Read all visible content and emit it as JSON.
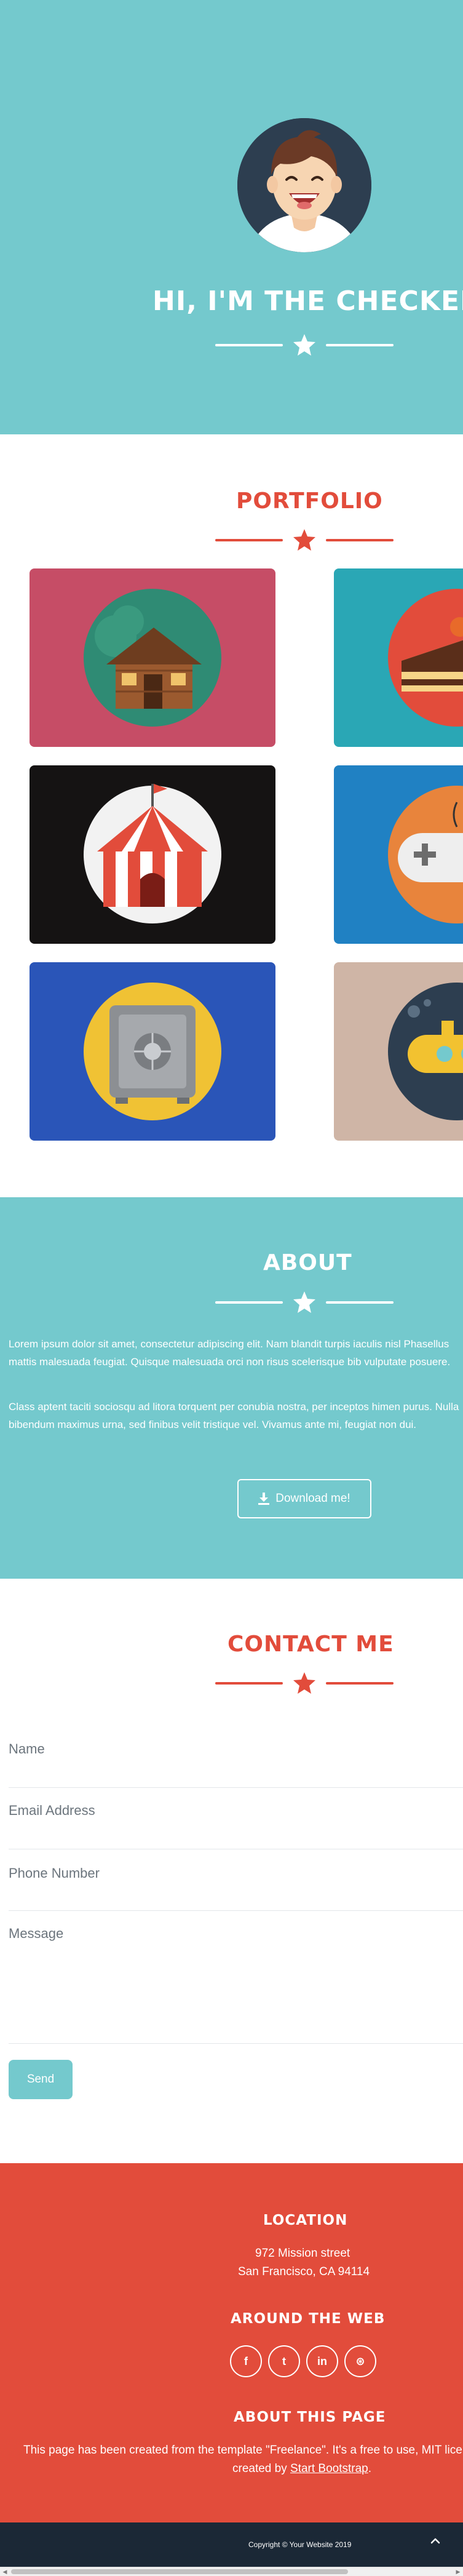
{
  "colors": {
    "teal": "#74c9cd",
    "red": "#e24c3b",
    "dark": "#2c3e50",
    "footer_dark": "#1b2836"
  },
  "masthead": {
    "title": "HI, I'M THE CHECKER!",
    "avatar_icon": "smiling-boy-avatar",
    "divider_icon": "star-icon"
  },
  "portfolio": {
    "heading": "PORTFOLIO",
    "items": [
      {
        "icon": "log-cabin-icon",
        "bg": "#c64d66"
      },
      {
        "icon": "cake-slice-icon",
        "bg": "#2aa7b5"
      },
      {
        "icon": "circus-tent-icon",
        "bg": "#151313"
      },
      {
        "icon": "game-controller-icon",
        "bg": "#2081c3"
      },
      {
        "icon": "safe-icon",
        "bg": "#2a55b8"
      },
      {
        "icon": "submarine-icon",
        "bg": "#cfb5a6"
      }
    ]
  },
  "about": {
    "heading": "ABOUT",
    "paragraph_1": "Lorem ipsum dolor sit amet, consectetur adipiscing elit. Nam blandit turpis iaculis nisl Phasellus mattis malesuada feugiat. Quisque malesuada orci non risus scelerisque bib vulputate posuere.",
    "paragraph_2": "Class aptent taciti sociosqu ad litora torquent per conubia nostra, per inceptos himen purus. Nulla bibendum maximus urna, sed finibus velit tristique vel. Vivamus ante mi, feugiat non dui.",
    "download_label": "Download me!",
    "download_icon": "download-icon"
  },
  "contact": {
    "heading": "CONTACT ME",
    "name_placeholder": "Name",
    "email_placeholder": "Email Address",
    "phone_placeholder": "Phone Number",
    "message_placeholder": "Message",
    "send_label": "Send"
  },
  "footer": {
    "location_heading": "LOCATION",
    "address_line_1": "972 Mission street",
    "address_line_2": "San Francisco, CA 94114",
    "web_heading": "AROUND THE WEB",
    "social": [
      {
        "icon": "facebook-icon",
        "glyph": "f"
      },
      {
        "icon": "twitter-icon",
        "glyph": "t"
      },
      {
        "icon": "linkedin-icon",
        "glyph": "in"
      },
      {
        "icon": "dribbble-icon",
        "glyph": "⊛"
      }
    ],
    "about_heading": "ABOUT THIS PAGE",
    "about_text": "This page has been created from the template \"Freelance\". It's a free to use, MIT lice",
    "created_by": "created by",
    "link_text": "Start Bootstrap",
    "period": "."
  },
  "copyright": {
    "text": "Copyright © Your Website 2019",
    "top_icon": "chevron-up-icon"
  }
}
